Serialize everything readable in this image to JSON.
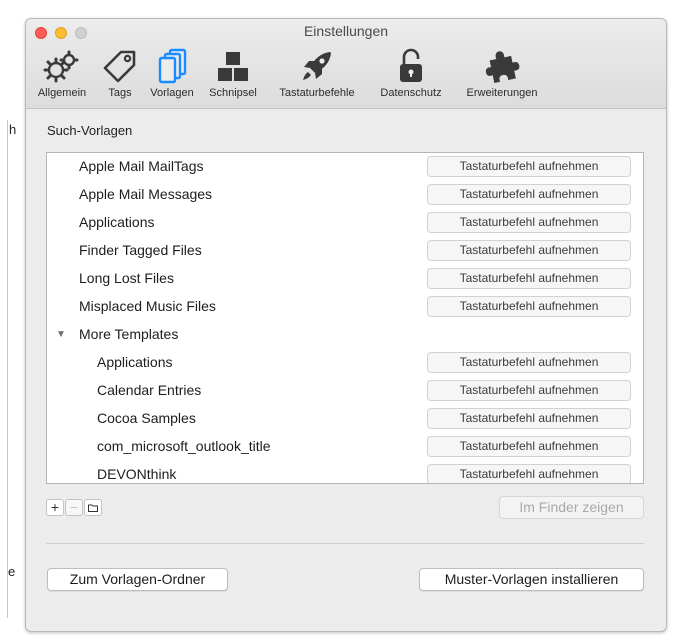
{
  "background": {
    "fragment_top": "h",
    "fragment_bottom": "e"
  },
  "window": {
    "title": "Einstellungen",
    "toolbar": [
      {
        "label": "Allgemein",
        "icon": "gears-icon"
      },
      {
        "label": "Tags",
        "icon": "tag-icon"
      },
      {
        "label": "Vorlagen",
        "icon": "templates-icon",
        "selected": true
      },
      {
        "label": "Schnipsel",
        "icon": "blocks-icon"
      },
      {
        "label": "Tastaturbefehle",
        "icon": "rocket-icon"
      },
      {
        "label": "Datenschutz",
        "icon": "padlock-icon"
      },
      {
        "label": "Erweiterungen",
        "icon": "puzzle-icon"
      }
    ]
  },
  "templates": {
    "section_label": "Such-Vorlagen",
    "shortcut_label": "Tastaturbefehl aufnehmen",
    "rows": [
      {
        "label": "Apple Mail MailTags"
      },
      {
        "label": "Apple Mail Messages"
      },
      {
        "label": "Applications"
      },
      {
        "label": "Finder Tagged Files"
      },
      {
        "label": "Long Lost Files"
      },
      {
        "label": "Misplaced Music Files"
      },
      {
        "label": "More Templates",
        "group": true,
        "expanded": true
      },
      {
        "label": "Applications",
        "indent": true
      },
      {
        "label": "Calendar Entries",
        "indent": true
      },
      {
        "label": "Cocoa Samples",
        "indent": true
      },
      {
        "label": "com_microsoft_outlook_title",
        "indent": true
      },
      {
        "label": "DEVONthink",
        "indent": true
      }
    ],
    "add_symbol": "+",
    "remove_symbol": "−",
    "folder_icon": "folder-icon",
    "show_in_finder": "Im Finder zeigen"
  },
  "footer": {
    "folder_button": "Zum Vorlagen-Ordner",
    "install_button": "Muster-Vorlagen installieren"
  },
  "colors": {
    "close": "#fd5f57",
    "minimize": "#febc2e",
    "selected_icon": "#1a8cff"
  }
}
